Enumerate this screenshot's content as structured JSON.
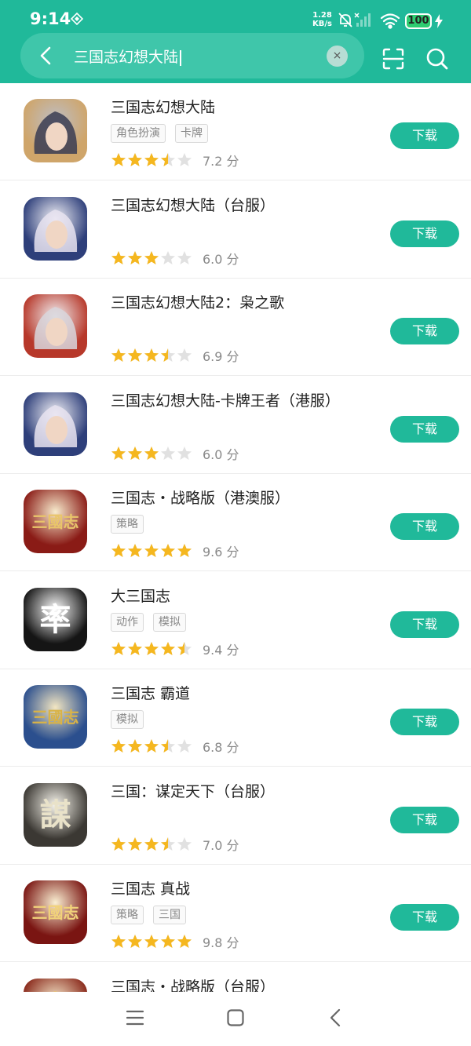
{
  "status_bar": {
    "time": "9:14",
    "net_speed_value": "1.28",
    "net_speed_unit": "KB/s",
    "battery": "100"
  },
  "search": {
    "query": "三国志幻想大陆",
    "clear_icon": "×"
  },
  "download_label": "下载",
  "apps": [
    {
      "name": "三国志幻想大陆",
      "tags": [
        "角色扮演",
        "卡牌"
      ],
      "stars": 3.5,
      "score": "7.2 分"
    },
    {
      "name": "三国志幻想大陆（台服）",
      "tags": [],
      "stars": 3,
      "score": "6.0 分"
    },
    {
      "name": "三国志幻想大陆2：枭之歌",
      "tags": [],
      "stars": 3.5,
      "score": "6.9 分"
    },
    {
      "name": "三国志幻想大陆-卡牌王者（港服）",
      "tags": [],
      "stars": 3,
      "score": "6.0 分"
    },
    {
      "name": "三国志・战略版（港澳服）",
      "tags": [
        "策略"
      ],
      "stars": 5,
      "score": "9.6 分"
    },
    {
      "name": "大三国志",
      "tags": [
        "动作",
        "模拟"
      ],
      "stars": 4.5,
      "score": "9.4 分"
    },
    {
      "name": "三国志 霸道",
      "tags": [
        "模拟"
      ],
      "stars": 3.5,
      "score": "6.8 分"
    },
    {
      "name": "三国：谋定天下（台服）",
      "tags": [],
      "stars": 3.5,
      "score": "7.0 分"
    },
    {
      "name": "三国志 真战",
      "tags": [
        "策略",
        "三国"
      ],
      "stars": 5,
      "score": "9.8 分"
    },
    {
      "name": "三国志・战略版（台服）",
      "tags": [],
      "stars": 0,
      "score": ""
    }
  ],
  "icon_art": [
    {
      "bg": "#cfa56a",
      "fg": "#3a3c52",
      "text": ""
    },
    {
      "bg": "#2e3f7a",
      "fg": "#e7e3f0",
      "text": ""
    },
    {
      "bg": "#b7382a",
      "fg": "#d8d6dc",
      "text": ""
    },
    {
      "bg": "#2e3f7a",
      "fg": "#e7e3f0",
      "text": ""
    },
    {
      "bg": "#8a1b16",
      "fg": "#e9c56a",
      "text": "三國志"
    },
    {
      "bg": "#151515",
      "fg": "#ffffff",
      "text": "率"
    },
    {
      "bg": "#2b4f8e",
      "fg": "#d9b347",
      "text": "三國志"
    },
    {
      "bg": "#3b3833",
      "fg": "#e9e2c9",
      "text": "謀"
    },
    {
      "bg": "#7a1512",
      "fg": "#f1d27a",
      "text": "三國志"
    },
    {
      "bg": "#8a2a1c",
      "fg": "#e9c56a",
      "text": ""
    }
  ],
  "colors": {
    "accent": "#20b99a",
    "star_on": "#f5b71f",
    "star_off": "#e1e1e1"
  },
  "nav": {
    "menu_icon": "menu-icon",
    "home_icon": "home-square-icon",
    "back_icon": "back-chevron-icon"
  }
}
